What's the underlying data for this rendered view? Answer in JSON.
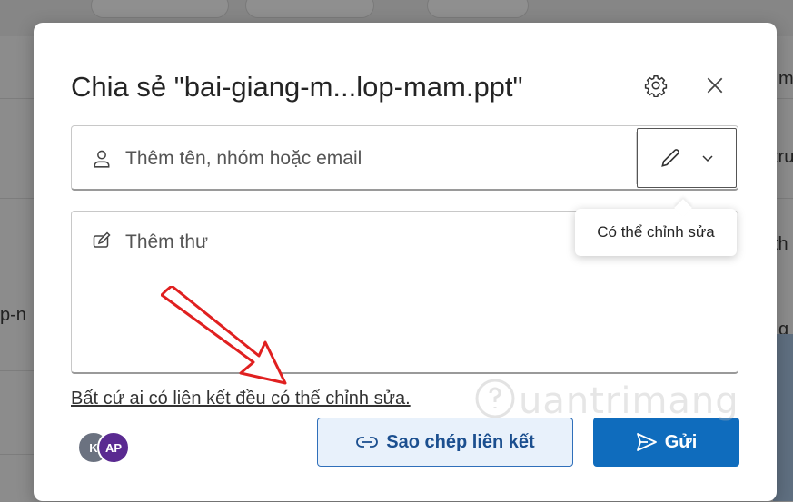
{
  "background": {
    "text_right_1": "m",
    "text_right_2": "tru",
    "text_right_3": "th",
    "text_left": "p-n",
    "text_right_4": "g",
    "text_right_5": "t",
    "text_right_6": "t"
  },
  "dialog": {
    "title": "Chia sẻ \"bai-giang-m...lop-mam.ppt\"",
    "settings_icon": "gear-icon",
    "close_icon": "close-icon"
  },
  "recipient": {
    "placeholder": "Thêm tên, nhóm hoặc email",
    "person_icon": "person-icon",
    "permission_icon": "pencil-icon",
    "chevron_icon": "chevron-down-icon"
  },
  "tooltip": {
    "text": "Có thể chỉnh sửa"
  },
  "message": {
    "placeholder": "Thêm thư",
    "compose_icon": "compose-icon"
  },
  "link_settings": {
    "text": "Bất cứ ai có liên kết đều có thể chỉnh sửa."
  },
  "avatars": [
    {
      "initials": "K",
      "color": "#6b7280"
    },
    {
      "initials": "AP",
      "color": "#5a2a91"
    }
  ],
  "buttons": {
    "copy_link": "Sao chép liên kết",
    "send": "Gửi"
  },
  "watermark": {
    "text": "uantrimang"
  },
  "colors": {
    "primary": "#0f6cbd",
    "secondary_bg": "#e8f1fb",
    "annotation": "#e02020"
  }
}
